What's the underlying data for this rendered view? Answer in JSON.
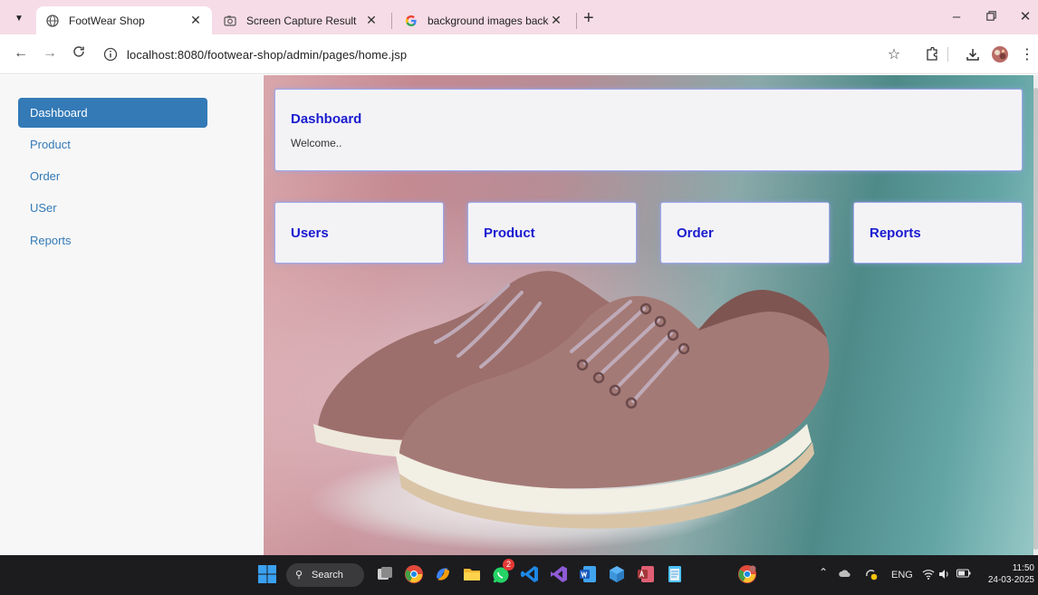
{
  "browser": {
    "tabs": [
      {
        "title": "FootWear Shop",
        "active": true
      },
      {
        "title": "Screen Capture Result",
        "active": false
      },
      {
        "title": "background images backgroun",
        "active": false
      }
    ],
    "url": "localhost:8080/footwear-shop/admin/pages/home.jsp"
  },
  "sidebar": {
    "items": [
      {
        "label": "Dashboard",
        "active": true
      },
      {
        "label": "Product",
        "active": false
      },
      {
        "label": "Order",
        "active": false
      },
      {
        "label": "USer",
        "active": false
      },
      {
        "label": "Reports",
        "active": false
      }
    ]
  },
  "main": {
    "header": {
      "title": "Dashboard",
      "subtitle": "Welcome.."
    },
    "cards": [
      "Users",
      "Product",
      "Order",
      "Reports"
    ]
  },
  "taskbar": {
    "search_label": "Search",
    "whatsapp_badge": "2",
    "language": "ENG",
    "time": "11:50",
    "date": "24-03-2025"
  },
  "colors": {
    "accent": "#337ab7",
    "card_title": "#1a1ad0",
    "tabstrip": "#f6dce6",
    "taskbar": "#1c1c1f"
  }
}
